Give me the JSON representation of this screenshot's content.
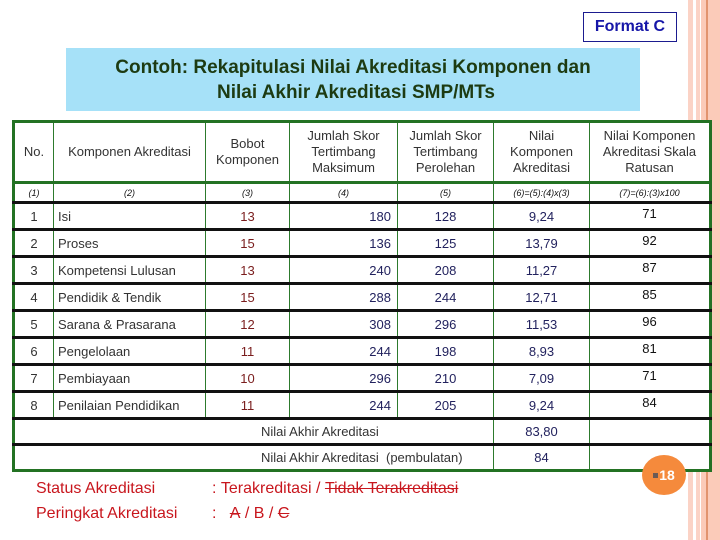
{
  "format_badge": "Format C",
  "title": {
    "line1": "Contoh: Rekapitulasi Nilai Akreditasi Komponen dan",
    "line2": "Nilai Akhir Akreditasi SMP/MTs"
  },
  "table": {
    "headers": [
      "No.",
      "Komponen Akreditasi",
      "Bobot Komponen",
      "Jumlah Skor Tertimbang Maksimum",
      "Jumlah Skor Tertimbang Perolehan",
      "Nilai Komponen Akreditasi",
      "Nilai Komponen Akreditasi Skala Ratusan"
    ],
    "column_numbers": [
      "(1)",
      "(2)",
      "(3)",
      "(4)",
      "(5)",
      "(6)=(5):(4)x(3)",
      "(7)=(6):(3)x100"
    ],
    "rows": [
      {
        "no": "1",
        "komponen": "Isi",
        "bobot": "13",
        "maksimum": "180",
        "perolehan": "128",
        "nilai": "9,24",
        "ratusan": "71"
      },
      {
        "no": "2",
        "komponen": "Proses",
        "bobot": "15",
        "maksimum": "136",
        "perolehan": "125",
        "nilai": "13,79",
        "ratusan": "92"
      },
      {
        "no": "3",
        "komponen": "Kompetensi Lulusan",
        "bobot": "13",
        "maksimum": "240",
        "perolehan": "208",
        "nilai": "11,27",
        "ratusan": "87"
      },
      {
        "no": "4",
        "komponen": "Pendidik & Tendik",
        "bobot": "15",
        "maksimum": "288",
        "perolehan": "244",
        "nilai": "12,71",
        "ratusan": "85"
      },
      {
        "no": "5",
        "komponen": "Sarana & Prasarana",
        "bobot": "12",
        "maksimum": "308",
        "perolehan": "296",
        "nilai": "11,53",
        "ratusan": "96"
      },
      {
        "no": "6",
        "komponen": "Pengelolaan",
        "bobot": "11",
        "maksimum": "244",
        "perolehan": "198",
        "nilai": "8,93",
        "ratusan": "81"
      },
      {
        "no": "7",
        "komponen": "Pembiayaan",
        "bobot": "10",
        "maksimum": "296",
        "perolehan": "210",
        "nilai": "7,09",
        "ratusan": "71"
      },
      {
        "no": "8",
        "komponen": "Penilaian Pendidikan",
        "bobot": "11",
        "maksimum": "244",
        "perolehan": "205",
        "nilai": "9,24",
        "ratusan": "84"
      }
    ],
    "summary": [
      {
        "label": "Nilai Akhir Akreditasi",
        "value": "83,80"
      },
      {
        "label": "Nilai Akhir Akreditasi  (pembulatan)",
        "value": "84"
      }
    ]
  },
  "status": {
    "status_label": "Status Akreditasi",
    "status_sep": ": ",
    "status_active": "Terakreditasi",
    "status_slash": " / ",
    "status_struck": "Tidak Terakreditasi",
    "peringkat_label": "Peringkat Akreditasi",
    "peringkat_sep": ":   ",
    "grade_a": "A",
    "grade_sep1": " / ",
    "grade_b": "B",
    "grade_sep2": " / ",
    "grade_c": "C"
  },
  "page_number": "18",
  "colors": {
    "title_band": "#a6e1f8",
    "table_border": "#237223",
    "status_text": "#c8161d",
    "page_badge": "#f58a3c",
    "format_badge_text": "#1616a8"
  }
}
